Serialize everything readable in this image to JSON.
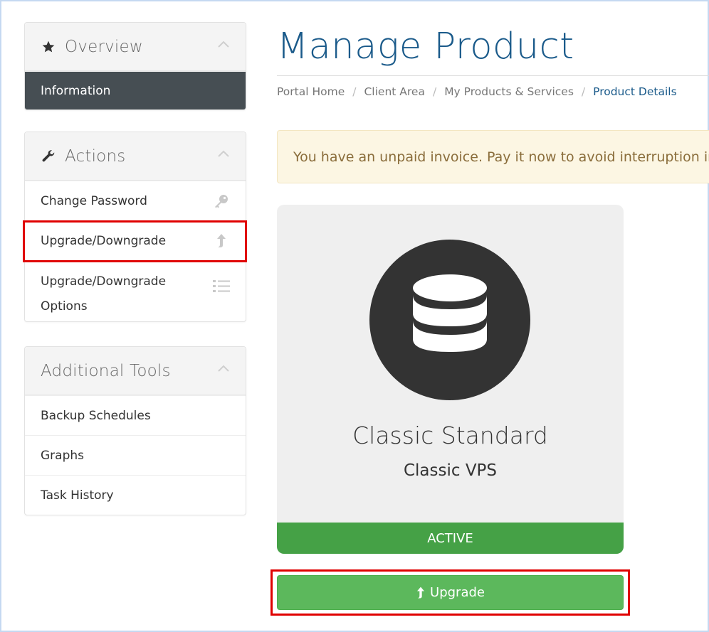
{
  "sidebar": {
    "overview": {
      "title": "Overview",
      "icon": "star-icon",
      "items": [
        {
          "label": "Information",
          "active": true
        }
      ]
    },
    "actions": {
      "title": "Actions",
      "icon": "wrench-icon",
      "items": [
        {
          "label": "Change Password",
          "icon": "key-icon"
        },
        {
          "label": "Upgrade/Downgrade",
          "icon": "arrow-up-icon",
          "highlighted": true
        },
        {
          "label": "Upgrade/Downgrade Options",
          "icon": "list-icon"
        }
      ]
    },
    "additional_tools": {
      "title": "Additional Tools",
      "items": [
        {
          "label": "Backup Schedules"
        },
        {
          "label": "Graphs"
        },
        {
          "label": "Task History"
        }
      ]
    }
  },
  "main": {
    "title": "Manage Product",
    "breadcrumb": [
      "Portal Home",
      "Client Area",
      "My Products & Services",
      "Product Details"
    ],
    "alert": "You have an unpaid invoice. Pay it now to avoid interruption in service.",
    "product": {
      "name": "Classic Standard",
      "group": "Classic VPS",
      "status": "ACTIVE",
      "icon": "database-icon"
    },
    "upgrade_button": "Upgrade"
  },
  "colors": {
    "title_blue": "#1a5a8a",
    "active_item_bg": "#464e53",
    "status_green": "#45a146",
    "button_green": "#5cb85c",
    "alert_bg": "#fcf6e3",
    "highlight_red": "#e00000"
  }
}
